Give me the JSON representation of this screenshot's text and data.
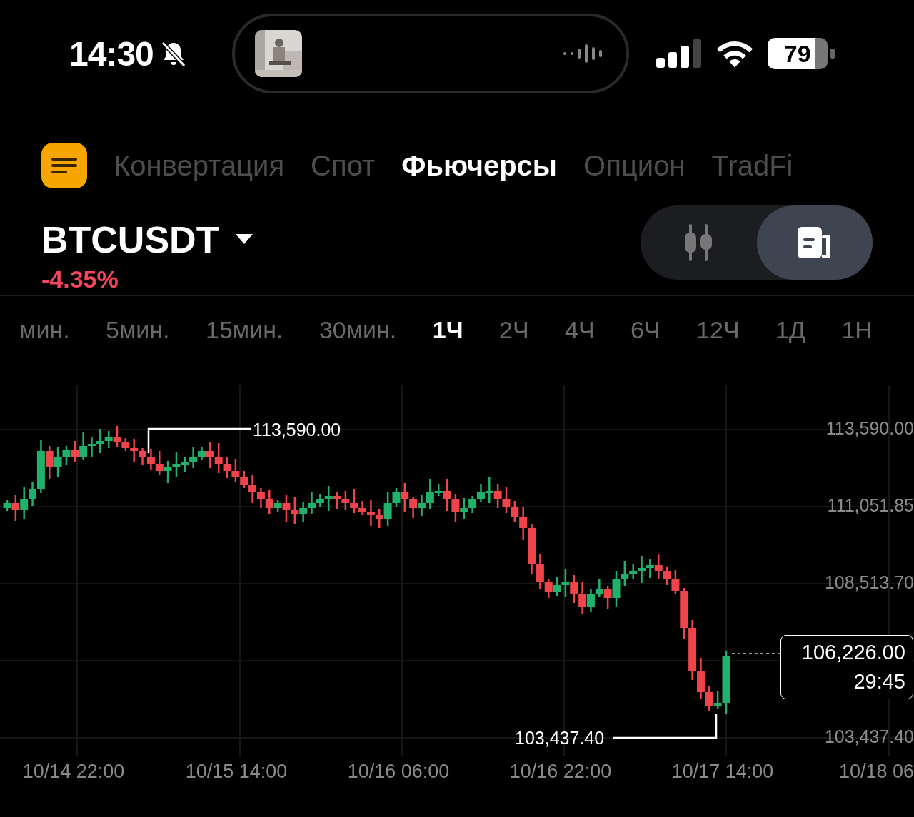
{
  "status_bar": {
    "time": "14:30",
    "silent": true,
    "battery": "79"
  },
  "nav_tabs": [
    {
      "label": "Конвертация",
      "selected": false
    },
    {
      "label": "Спот",
      "selected": false
    },
    {
      "label": "Фьючерсы",
      "selected": true
    },
    {
      "label": "Опцион",
      "selected": false
    },
    {
      "label": "TradFi",
      "selected": false
    }
  ],
  "symbol": {
    "name": "BTCUSDT",
    "change": "-4.35%"
  },
  "view_toggle": [
    {
      "kind": "candles",
      "selected": false
    },
    {
      "kind": "details",
      "selected": true
    }
  ],
  "intervals": [
    {
      "label": "мин.",
      "selected": false
    },
    {
      "label": "5мин.",
      "selected": false
    },
    {
      "label": "15мин.",
      "selected": false
    },
    {
      "label": "30мин.",
      "selected": false
    },
    {
      "label": "1Ч",
      "selected": true
    },
    {
      "label": "2Ч",
      "selected": false
    },
    {
      "label": "4Ч",
      "selected": false
    },
    {
      "label": "6Ч",
      "selected": false
    },
    {
      "label": "12Ч",
      "selected": false
    },
    {
      "label": "1Д",
      "selected": false
    },
    {
      "label": "1Н",
      "selected": false
    }
  ],
  "chart": {
    "price_labels": [
      "113,590.00",
      "111,051.85",
      "108,513.70",
      "103,437.40"
    ],
    "time_labels": [
      "10/14 22:00",
      "10/15 14:00",
      "10/16 06:00",
      "10/16 22:00",
      "10/17 14:00",
      "10/18 06"
    ],
    "high_marker": "113,590.00",
    "low_marker": "103,437.40",
    "last_price": {
      "value": "106,226.00",
      "countdown": "29:45"
    }
  }
}
